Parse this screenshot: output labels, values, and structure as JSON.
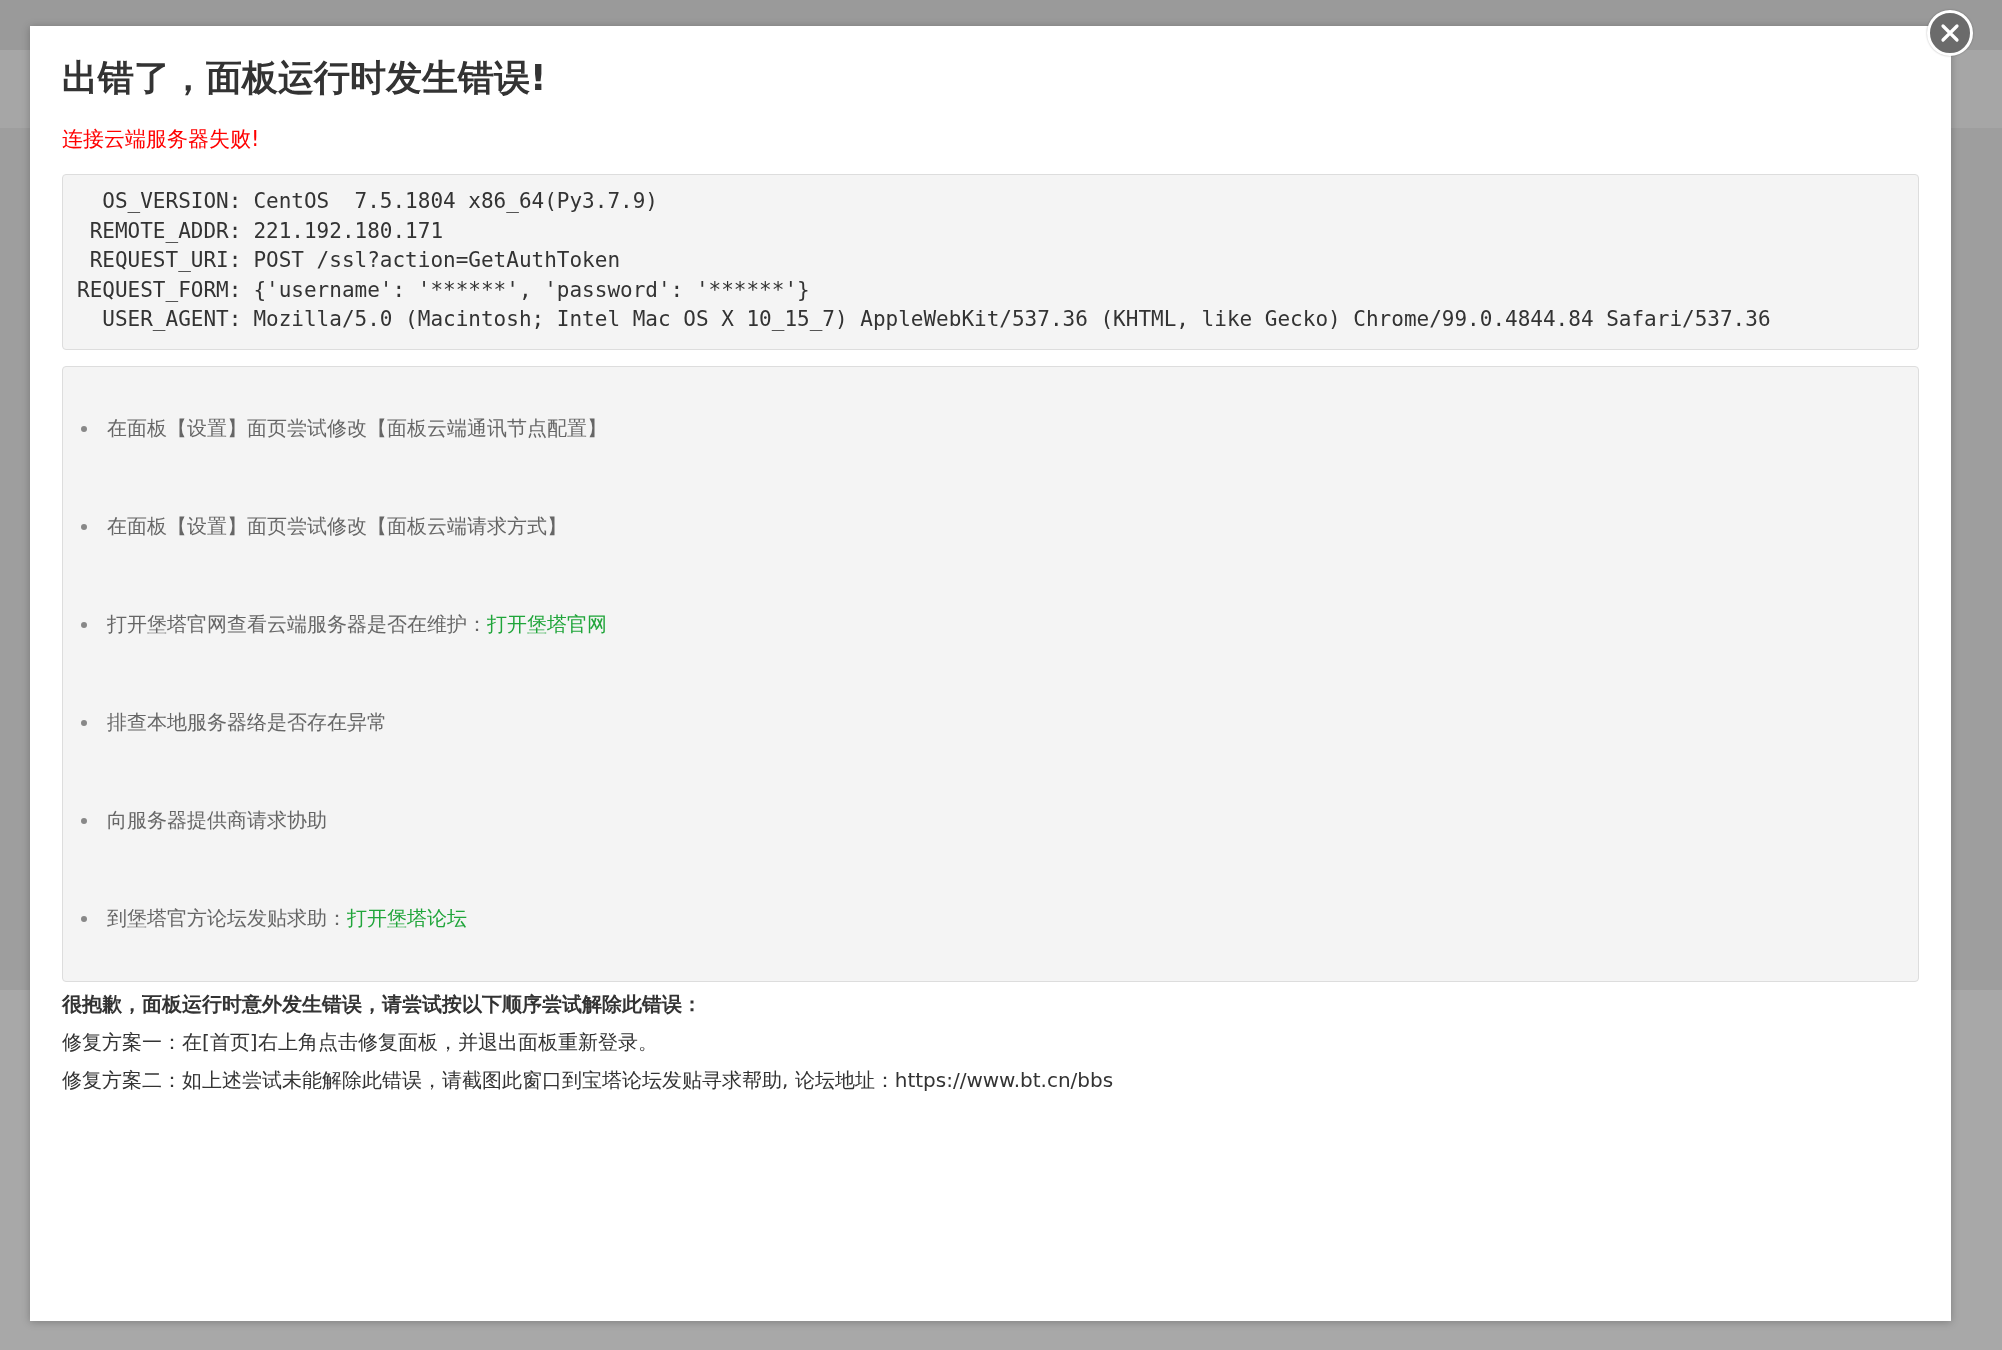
{
  "dialog": {
    "title": "出错了，面板运行时发生错误!",
    "error_message": "连接云端服务器失败!",
    "details": [
      {
        "key": "OS_VERSION:",
        "value": "CentOS  7.5.1804 x86_64(Py3.7.9)"
      },
      {
        "key": "REMOTE_ADDR:",
        "value": "221.192.180.171"
      },
      {
        "key": "REQUEST_URI:",
        "value": "POST /ssl?action=GetAuthToken"
      },
      {
        "key": "REQUEST_FORM:",
        "value": "{'username': '******', 'password': '******'}"
      },
      {
        "key": "USER_AGENT:",
        "value": "Mozilla/5.0 (Macintosh; Intel Mac OS X 10_15_7) AppleWebKit/537.36 (KHTML, like Gecko) Chrome/99.0.4844.84 Safari/537.36"
      }
    ],
    "suggestions": [
      {
        "text": "在面板【设置】面页尝试修改【面板云端通讯节点配置】"
      },
      {
        "text": "在面板【设置】面页尝试修改【面板云端请求方式】"
      },
      {
        "text": "打开堡塔官网查看云端服务器是否在维护：",
        "link": "打开堡塔官网"
      },
      {
        "text": "排查本地服务器络是否存在异常"
      },
      {
        "text": "向服务器提供商请求协助"
      },
      {
        "text": "到堡塔官方论坛发贴求助：",
        "link": "打开堡塔论坛"
      }
    ],
    "help_heading": "很抱歉，面板运行时意外发生错误，请尝试按以下顺序尝试解除此错误：",
    "help_lines": [
      "修复方案一：在[首页]右上角点击修复面板，并退出面板重新登录。",
      "修复方案二：如上述尝试未能解除此错误，请截图此窗口到宝塔论坛发贴寻求帮助, 论坛地址：https://www.bt.cn/bbs"
    ]
  }
}
